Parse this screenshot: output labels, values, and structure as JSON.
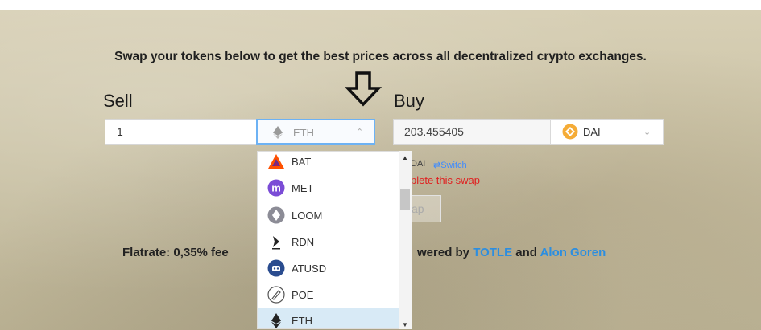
{
  "headline": "Swap your tokens below to get the best prices across all decentralized crypto exchanges.",
  "sell": {
    "label": "Sell",
    "amount": "1",
    "token": "ETH"
  },
  "buy": {
    "label": "Buy",
    "amount": "203.455405",
    "token": "DAI"
  },
  "dropdown": {
    "items": [
      {
        "symbol": "BAT",
        "icon": "bat-token-icon"
      },
      {
        "symbol": "MET",
        "icon": "met-token-icon"
      },
      {
        "symbol": "LOOM",
        "icon": "loom-token-icon"
      },
      {
        "symbol": "RDN",
        "icon": "rdn-token-icon"
      },
      {
        "symbol": "ATUSD",
        "icon": "atusd-token-icon"
      },
      {
        "symbol": "POE",
        "icon": "poe-token-icon"
      },
      {
        "symbol": "ETH",
        "icon": "eth-token-icon",
        "selected": true
      }
    ]
  },
  "rate": {
    "token_partial": "DAI",
    "switch_label": "⇄Switch"
  },
  "error_partial": "plete this swap",
  "swap_partial": "ap",
  "footer": {
    "left_partial": "Flatrate: 0,35% fee",
    "right_partial": "wered by",
    "link1": "TOTLE",
    "and": "and",
    "link2": "Alon Goren"
  },
  "colors": {
    "accent": "#6db2f4",
    "link": "#2c8ee0",
    "error": "#e02020",
    "dai": "#f5ac37",
    "selected_row": "#d8eaf6"
  }
}
